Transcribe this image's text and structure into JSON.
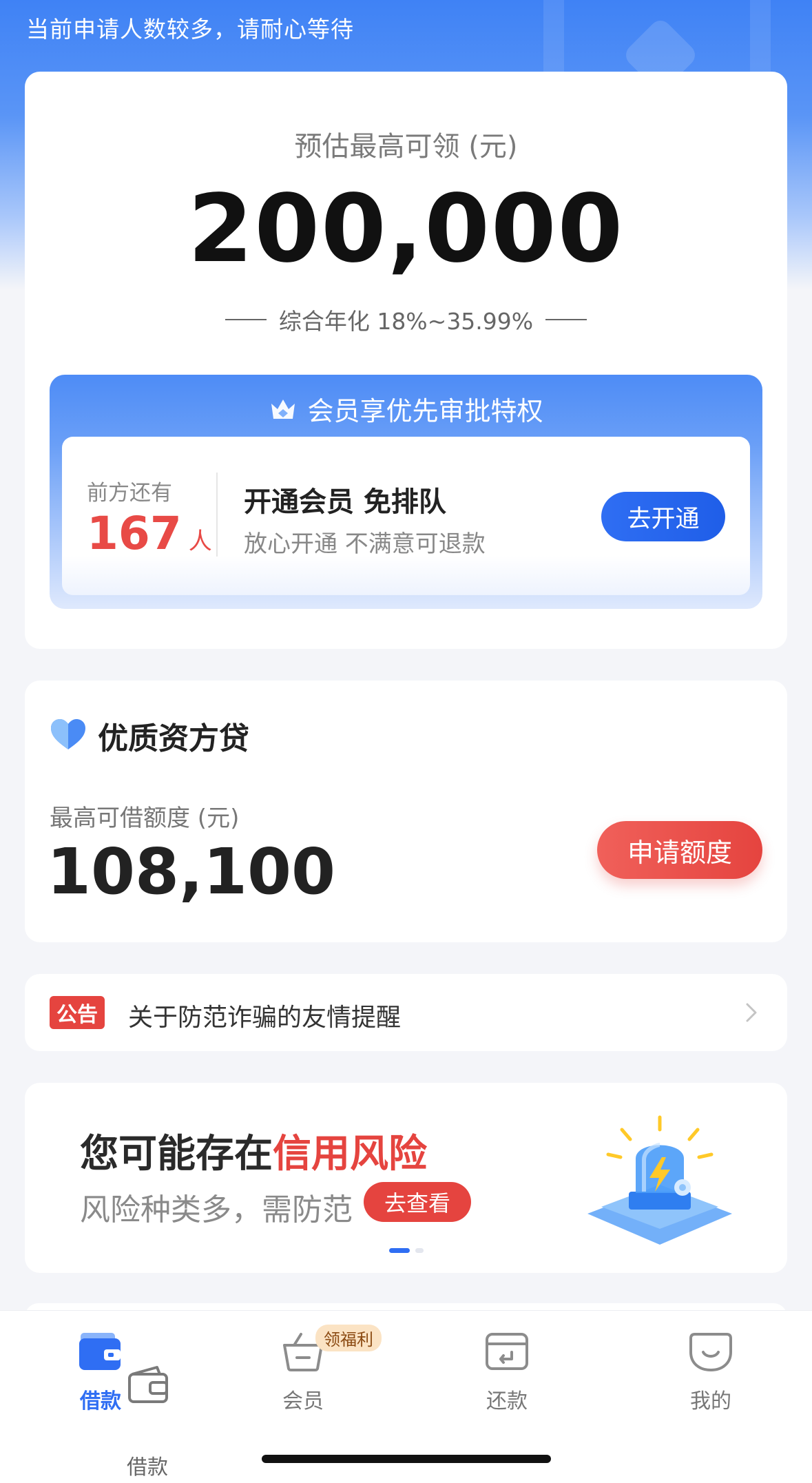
{
  "status_notice": "当前申请人数较多，请耐心等待",
  "main_card": {
    "estimate_label": "预估最高可领 (元)",
    "estimate_amount": "200,000",
    "annual_rate": "综合年化 18%~35.99%",
    "vip": {
      "title": "会员享优先审批特权",
      "queue_label": "前方还有",
      "queue_count": "167",
      "queue_unit": "人",
      "headline": "开通会员 免排队",
      "subline": "放心开通 不满意可退款",
      "open_button": "去开通"
    }
  },
  "loan_card": {
    "title": "优质资方贷",
    "limit_label": "最高可借额度 (元)",
    "limit_amount": "108,100",
    "apply_button": "申请额度"
  },
  "announcement": {
    "tag": "公告",
    "text": "关于防范诈骗的友情提醒"
  },
  "risk_banner": {
    "title_prefix": "您可能存在",
    "title_highlight": "信用风险",
    "subtitle": "风险种类多，需防范",
    "view_button": "去查看",
    "carousel_page": 1,
    "carousel_total": 2
  },
  "tabbar": {
    "tabs": [
      {
        "label": "借款",
        "icon": "wallet-icon",
        "active": true
      },
      {
        "label": "会员",
        "icon": "basket-icon",
        "active": false,
        "badge": "领福利"
      },
      {
        "label": "还款",
        "icon": "repay-card-icon",
        "active": false
      },
      {
        "label": "我的",
        "icon": "smile-face-icon",
        "active": false
      }
    ],
    "ghost_label": "借款"
  },
  "colors": {
    "primary_blue": "#2f6ef3",
    "accent_red": "#e5443f",
    "badge_bg": "#fbe3c4"
  }
}
